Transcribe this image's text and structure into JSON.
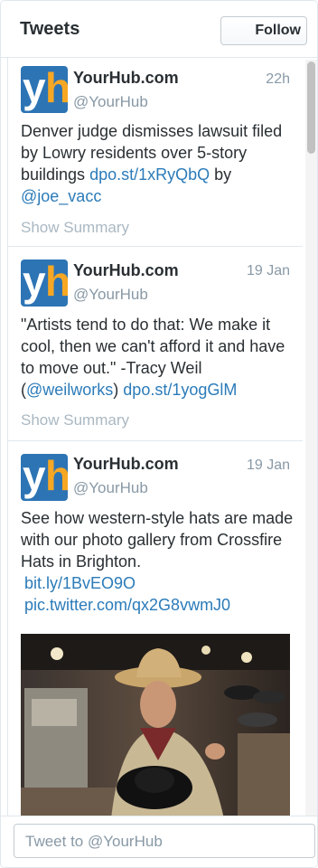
{
  "header": {
    "title": "Tweets",
    "follow_label": "Follow"
  },
  "tweets": [
    {
      "display_name": "YourHub.com",
      "screen_name": "@YourHub",
      "timestamp": "22h",
      "text_parts": [
        "Denver judge dismisses lawsuit filed by Lowry residents over 5-story buildings ",
        "dpo.st/1xRyQbQ",
        " by ",
        "@joe_vacc"
      ],
      "show_summary": "Show Summary"
    },
    {
      "display_name": "YourHub.com",
      "screen_name": "@YourHub",
      "timestamp": "19 Jan",
      "text_parts": [
        "\"Artists tend to do that: We make it cool, then we can't afford it and have to move out.\" -Tracy Weil (",
        "@weilworks",
        ") ",
        "dpo.st/1yogGlM"
      ],
      "show_summary": "Show Summary"
    },
    {
      "display_name": "YourHub.com",
      "screen_name": "@YourHub",
      "timestamp": "19 Jan",
      "text_parts": [
        "See how western-style hats are made with our photo gallery from Crossfire Hats in Brighton. ",
        "bit.ly/1BvEO9O",
        "pic.twitter.com/qx2G8vwmJ0"
      ]
    }
  ],
  "avatar_letters": {
    "first": "y",
    "second": "h"
  },
  "footer": {
    "tweetbox_placeholder": "Tweet to @YourHub"
  },
  "colors": {
    "link": "#2b7bb9",
    "avatar_blue": "#2d74b5",
    "avatar_orange": "#f7a723",
    "muted": "#8899a6"
  }
}
